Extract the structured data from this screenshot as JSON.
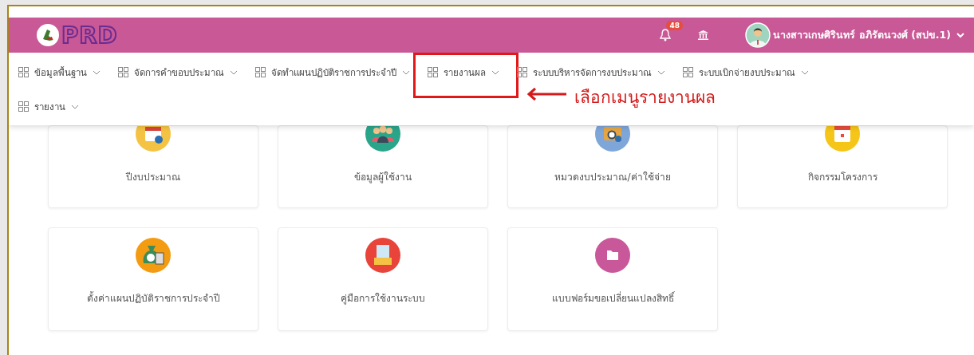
{
  "logo": {
    "text": "PRD"
  },
  "header": {
    "notification_count": "48",
    "user_name": "นางสาวเกษศิรินทร์ อภิรัตนวงศ์ (สปข.1)"
  },
  "menu": [
    {
      "label": "ข้อมูลพื้นฐาน",
      "annotated": false
    },
    {
      "label": "จัดการคำขอบประมาณ",
      "annotated": false
    },
    {
      "label": "จัดทำแผนปฏิบัติราชการประจำปี",
      "annotated": false
    },
    {
      "label": "รายงานผล",
      "annotated": true
    },
    {
      "label": "ระบบบริหารจัดการงบประมาณ",
      "annotated": false
    },
    {
      "label": "ระบบเบิกจ่ายงบประมาณ",
      "annotated": false
    },
    {
      "label": "รายงาน",
      "annotated": false
    }
  ],
  "annotation": {
    "text": "เลือกเมนูรายงานผล"
  },
  "cards": [
    {
      "label": "ปีงบประมาณ",
      "kind": "calendar"
    },
    {
      "label": "ข้อมูลผู้ใช้งาน",
      "kind": "people"
    },
    {
      "label": "หมวดงบประมาณ/ค่าใช้จ่าย",
      "kind": "search-folder"
    },
    {
      "label": "กิจกรรมโครงการ",
      "kind": "event"
    },
    {
      "label": "ตั้งค่าแผนปฏิบัติราชการประจำปี",
      "kind": "money"
    },
    {
      "label": "คู่มือการใช้งานระบบ",
      "kind": "manual"
    },
    {
      "label": "แบบฟอร์มขอเปลี่ยนแปลงสิทธิ์",
      "kind": "folder"
    }
  ]
}
